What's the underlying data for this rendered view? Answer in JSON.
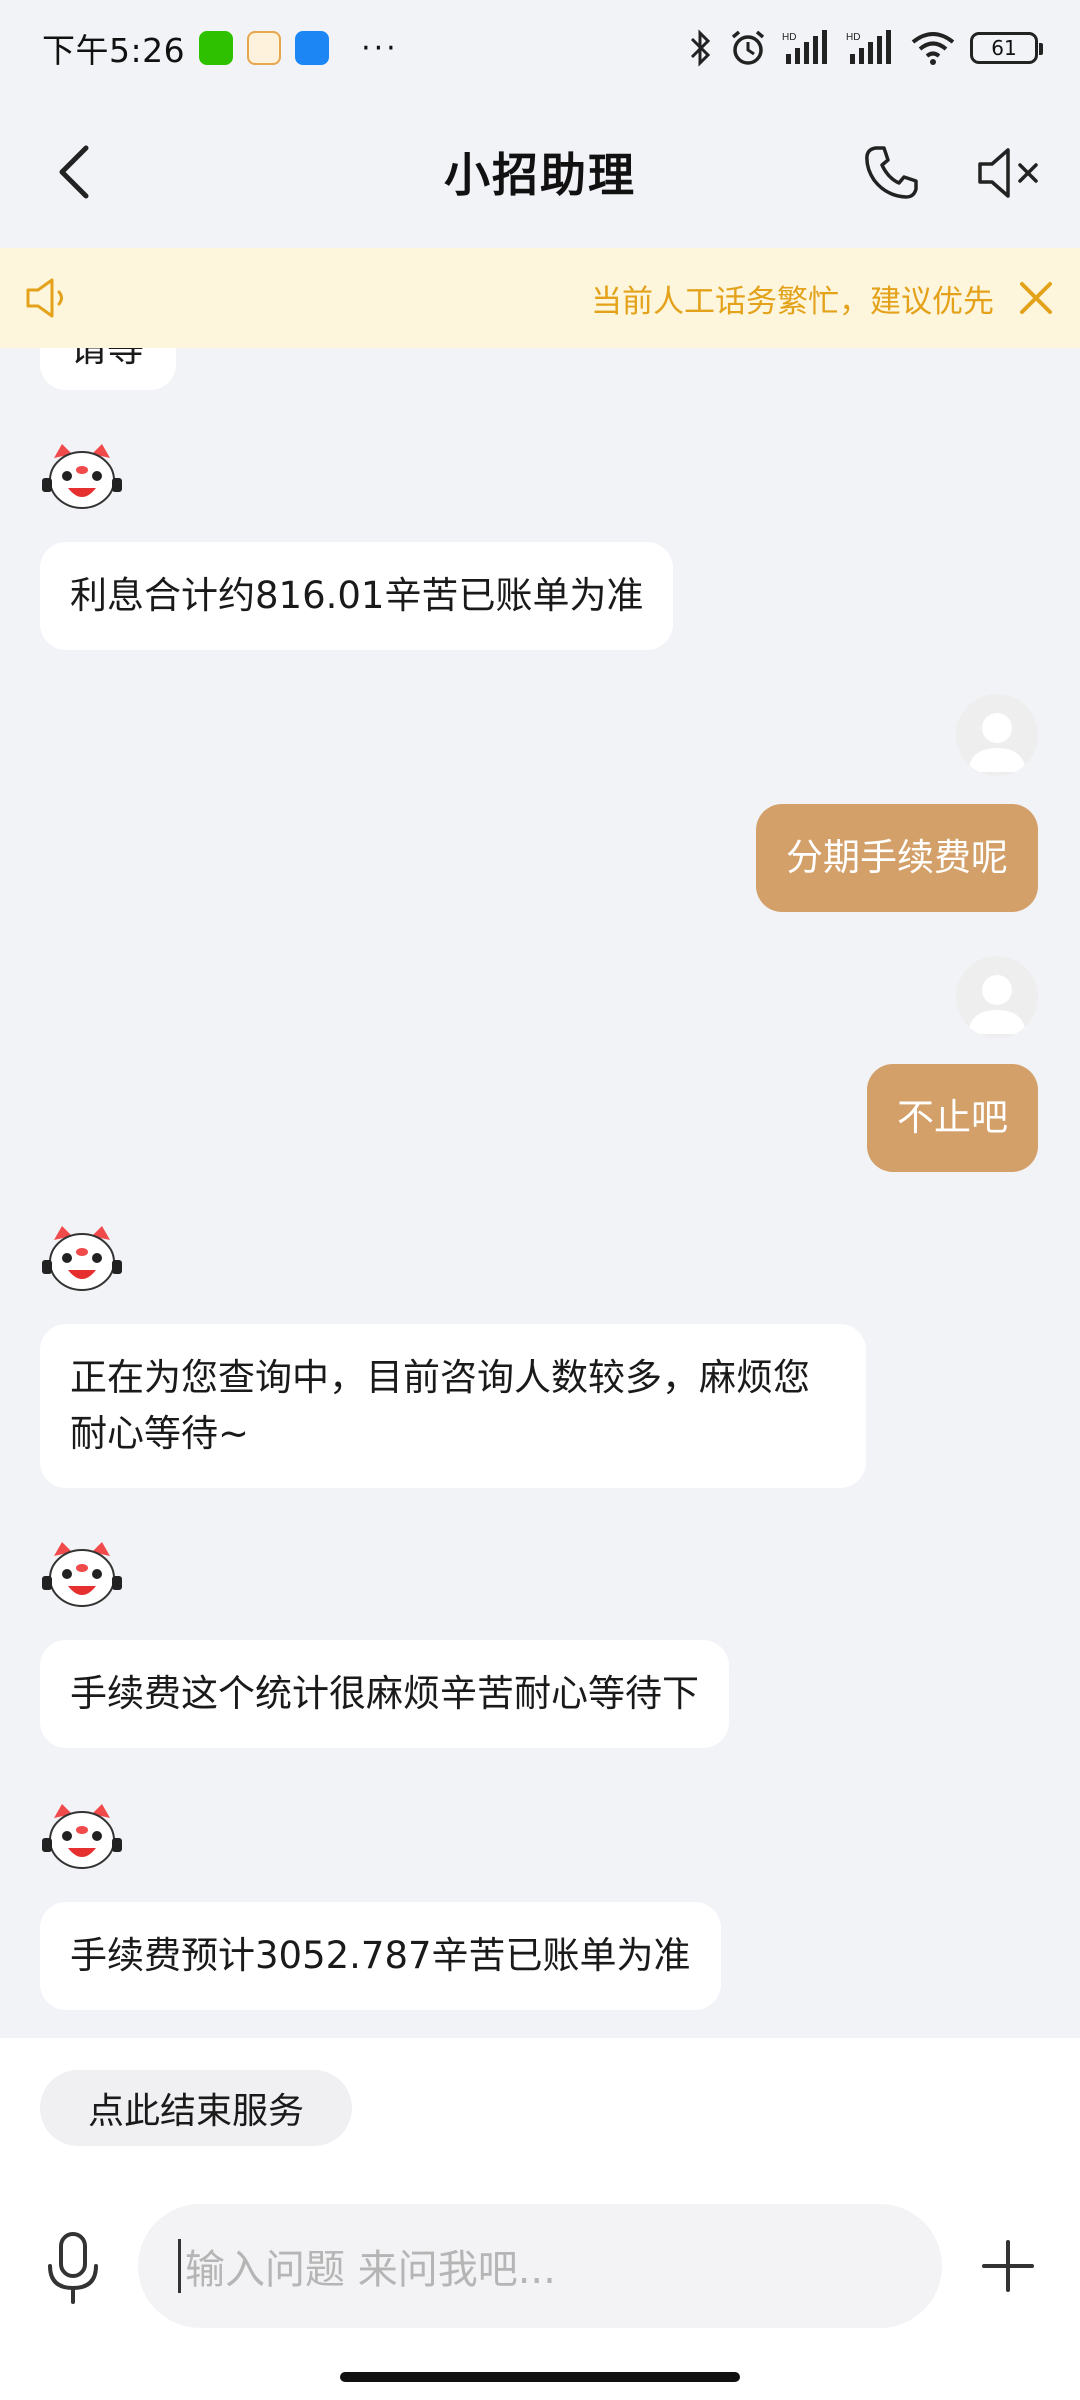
{
  "status_bar": {
    "time": "下午5:26",
    "more": "···",
    "battery": "61"
  },
  "nav": {
    "title": "小招助理"
  },
  "notice": {
    "text": "当前人工话务繁忙，建议优先"
  },
  "messages": {
    "partial": "请等",
    "bot1": "利息合计约816.01辛苦已账单为准",
    "user1": "分期手续费呢",
    "user2": "不止吧",
    "bot2": "正在为您查询中，目前咨询人数较多，麻烦您耐心等待~",
    "bot3": "手续费这个统计很麻烦辛苦耐心等待下",
    "bot4": "手续费预计3052.787辛苦已账单为准"
  },
  "bottom": {
    "end_service": "点此结束服务",
    "input_placeholder": "输入问题 来问我吧..."
  },
  "colors": {
    "user_bubble": "#d3a06a",
    "notice_text": "#e3a21a",
    "notice_bg": "#fdf6dd"
  }
}
